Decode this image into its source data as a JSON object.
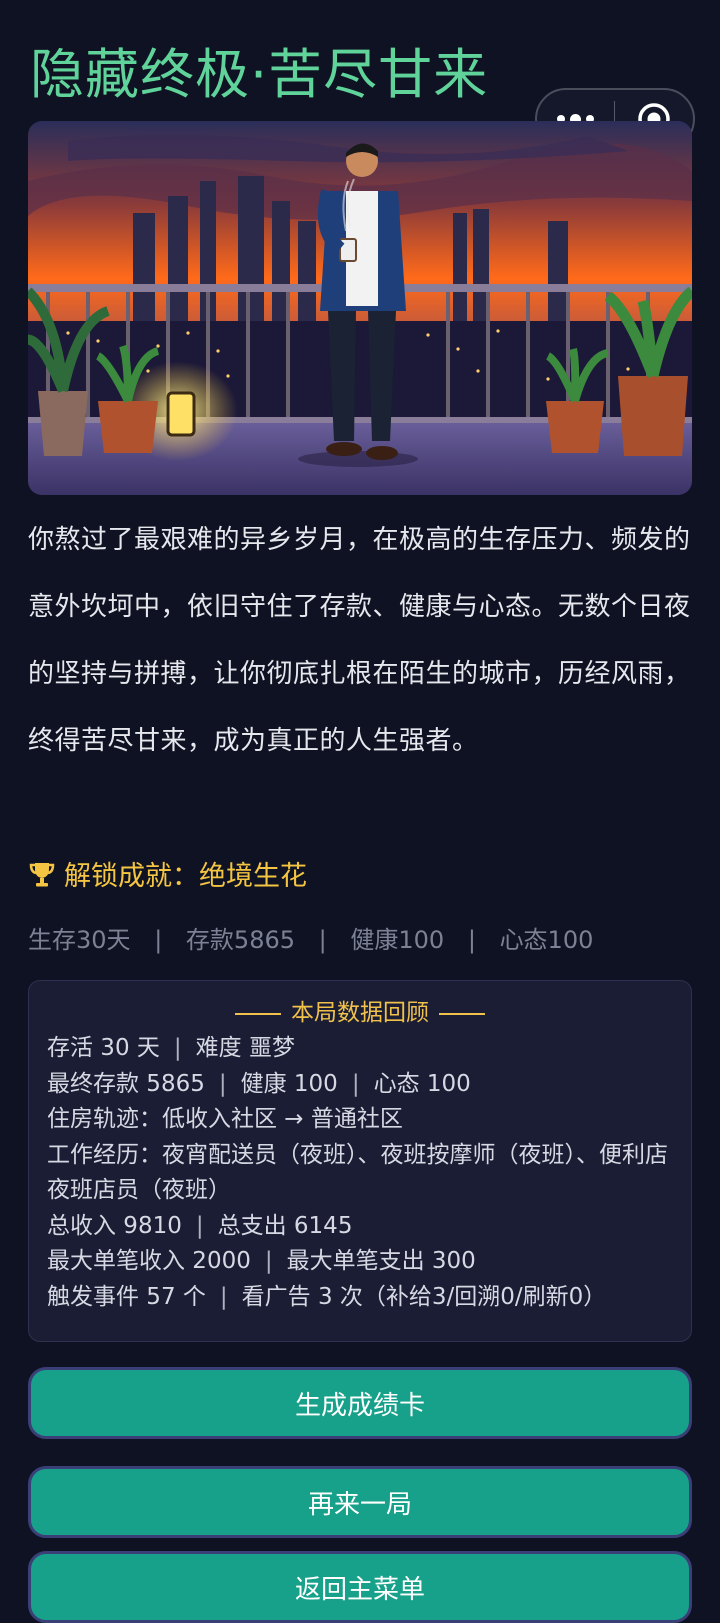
{
  "page": {
    "title": "隐藏终极·苦尽甘来"
  },
  "capsule": {
    "more_icon": "more-dots-icon",
    "close_icon": "target-circle-icon"
  },
  "hero": {
    "description": "Man in blue blazer holding coffee on a rooftop terrace overlooking a city skyline at dusk"
  },
  "story": {
    "text": "你熬过了最艰难的异乡岁月，在极高的生存压力、频发的意外坎坷中，依旧守住了存款、健康与心态。无数个日夜的坚持与拼搏，让你彻底扎根在陌生的城市，历经风雨，终得苦尽甘来，成为真正的人生强者。"
  },
  "achievement": {
    "icon": "trophy-icon",
    "label": "解锁成就：绝境生花"
  },
  "stats": {
    "separator": "|",
    "items": [
      "生存30天",
      "存款5865",
      "健康100",
      "心态100"
    ]
  },
  "review": {
    "title": "本局数据回顾",
    "separator": "|",
    "survive": "存活 30 天",
    "difficulty": "难度 噩梦",
    "final_savings": "最终存款 5865",
    "health": "健康 100",
    "mood": "心态 100",
    "housing": "住房轨迹：低收入社区 → 普通社区",
    "jobs": "工作经历：夜宵配送员（夜班）、夜班按摩师（夜班）、便利店夜班店员（夜班）",
    "total_income": "总收入 9810",
    "total_expense": "总支出 6145",
    "max_income": "最大单笔收入 2000",
    "max_expense": "最大单笔支出 300",
    "events": "触发事件 57 个",
    "ads": "看广告 3 次（补给3/回溯0/刷新0）"
  },
  "buttons": {
    "generate_card": "生成成绩卡",
    "play_again": "再来一局",
    "main_menu": "返回主菜单"
  },
  "colors": {
    "background": "#0f1222",
    "title": "#5fd39a",
    "achievement": "#f4c542",
    "button": "#17a08a",
    "button_border": "#3a3f78"
  }
}
